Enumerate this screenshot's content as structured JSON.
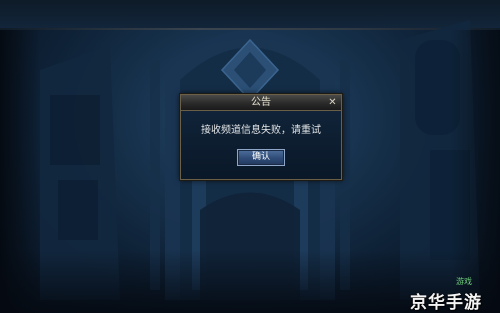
{
  "dialog": {
    "title": "公告",
    "message": "接收频道信息失败，请重试",
    "confirm_label": "确认",
    "close_glyph": "✕"
  },
  "watermark": {
    "text": "京华手游",
    "badge": "游戏"
  },
  "colors": {
    "dialog_border": "#6b6047",
    "confirm_button": "#2f4c78",
    "background": "#183450"
  }
}
